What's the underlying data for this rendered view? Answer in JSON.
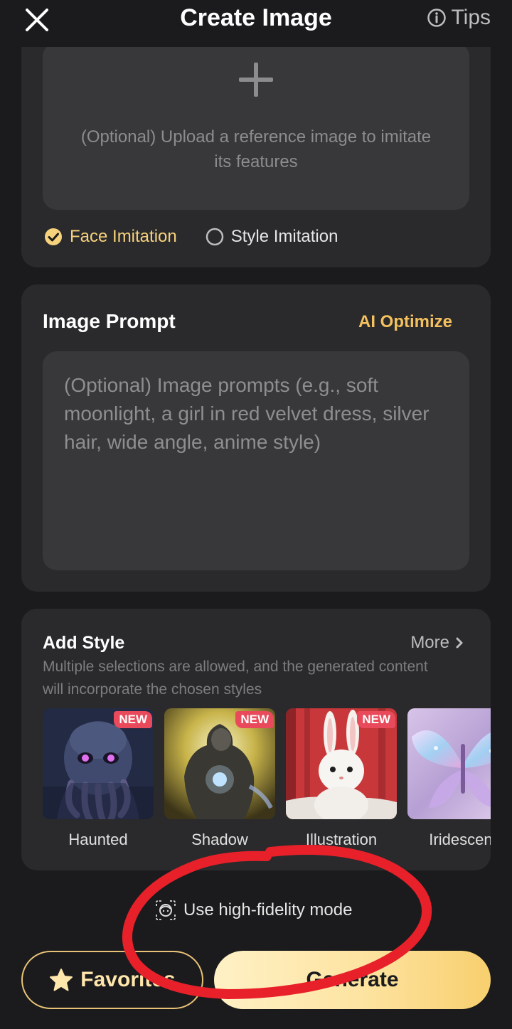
{
  "header": {
    "title": "Create Image",
    "tips_label": "Tips",
    "close_icon": "close-icon",
    "tips_icon": "info-icon"
  },
  "upload": {
    "hint": "(Optional) Upload a reference image to imitate its features",
    "plus_icon": "plus-icon",
    "options": [
      {
        "label": "Face Imitation",
        "selected": true
      },
      {
        "label": "Style Imitation",
        "selected": false
      }
    ]
  },
  "prompt": {
    "title": "Image Prompt",
    "optimize_label": "AI Optimize",
    "placeholder": "(Optional) Image prompts (e.g., soft moonlight, a girl in red velvet dress, silver hair, wide angle, anime style)",
    "value": ""
  },
  "style": {
    "title": "Add Style",
    "more_label": "More",
    "description": "Multiple selections are allowed, and the generated content will incorporate the chosen styles",
    "items": [
      {
        "label": "Haunted",
        "badge": "NEW"
      },
      {
        "label": "Shadow",
        "badge": "NEW"
      },
      {
        "label": "Illustration",
        "badge": "NEW"
      },
      {
        "label": "Iridescent",
        "badge": ""
      }
    ]
  },
  "hifi": {
    "label": "Use high-fidelity mode",
    "icon": "face-scan-icon"
  },
  "actions": {
    "favorites_label": "Favorites",
    "generate_label": "Generate",
    "star_icon": "star-icon"
  },
  "colors": {
    "accent_gold": "#f4c15e",
    "badge_red": "#e84a5b",
    "annotation_red": "#e8202a",
    "background": "#1b1b1d",
    "card": "#2a2a2c"
  }
}
